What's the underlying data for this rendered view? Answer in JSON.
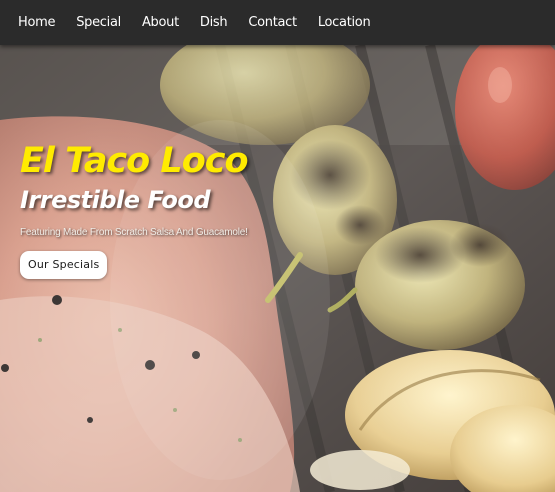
{
  "nav": {
    "items": [
      {
        "label": "Home"
      },
      {
        "label": "Special"
      },
      {
        "label": "About"
      },
      {
        "label": "Dish"
      },
      {
        "label": "Contact"
      },
      {
        "label": "Location"
      }
    ]
  },
  "hero": {
    "title": "El Taco Loco",
    "subtitle": "Irrestible Food",
    "tagline": "Featuring Made From Scratch Salsa And Guacamole!",
    "button_label": "Our Specials",
    "image": "grilled-meat-and-peppers-photo"
  },
  "colors": {
    "nav_background": "#2b2b2b",
    "title_yellow": "#ffeb00",
    "button_background": "#ffffff"
  }
}
